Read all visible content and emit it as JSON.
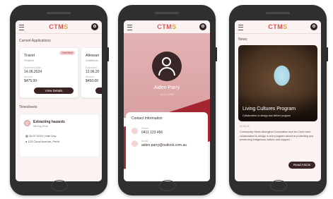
{
  "brand": {
    "logo_main": "CTM",
    "logo_accent": "S"
  },
  "phone1": {
    "section_title": "Current Applications",
    "cards": [
      {
        "category": "Travel",
        "subtitle": "Federal",
        "badge": "Submitted",
        "date_label": "Submitted Date",
        "date_value": "14.06.2024",
        "amount_label": "Amount",
        "amount_value": "$475.00",
        "button": "View Details"
      },
      {
        "category": "Allowan",
        "subtitle": "Additional",
        "date_label": "Submitted",
        "date_value": "12.06.20",
        "amount_label": "Amount",
        "amount_value": "$450.00"
      }
    ],
    "timesheets_title": "Timesheets",
    "timesheet": {
      "title": "Extracting hazards",
      "subtitle": "Mining Role",
      "date": "15.07.2024 | Half Day",
      "location": "123 Cloud Avenue, Perth"
    }
  },
  "phone2": {
    "name": "Aiden Parry",
    "dob": "22.01.1990",
    "contact_title": "Contact Information",
    "phone_label": "Phone",
    "phone_value": "0411 123 456",
    "email_label": "Email",
    "email_value": "aiden.parry@outlook.com.au"
  },
  "phone3": {
    "section_title": "News",
    "article_title": "Living Cultures Program",
    "article_subtitle": "Collaboration to design and deliver program",
    "date": "03.06.24",
    "body": "Community News Aboriginal Corporation and for Crew have collaborated to design a new program aimed at protecting and preserving indigenous culture and support...",
    "button": "Read Article"
  },
  "colors": {
    "accent": "#a42630",
    "dark_button": "#3b2323",
    "hero_pink": "#e4b3b4"
  }
}
